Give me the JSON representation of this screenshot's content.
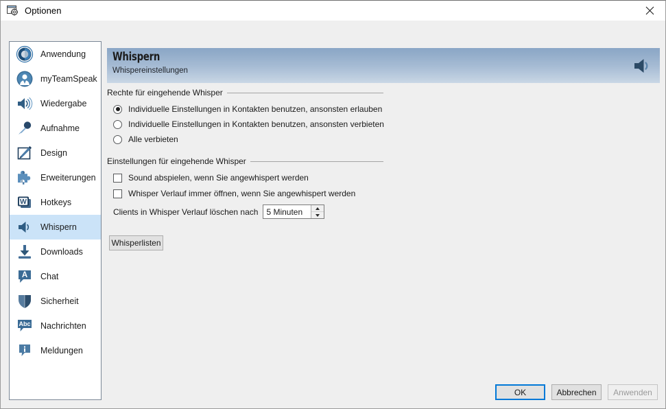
{
  "window": {
    "title": "Optionen",
    "icon": "options-window-icon",
    "close_label": "×"
  },
  "sidebar": {
    "items": [
      {
        "label": "Anwendung",
        "icon": "application-icon",
        "selected": false
      },
      {
        "label": "myTeamSpeak",
        "icon": "user-account-icon",
        "selected": false
      },
      {
        "label": "Wiedergabe",
        "icon": "playback-icon",
        "selected": false
      },
      {
        "label": "Aufnahme",
        "icon": "microphone-icon",
        "selected": false
      },
      {
        "label": "Design",
        "icon": "design-pencil-icon",
        "selected": false
      },
      {
        "label": "Erweiterungen",
        "icon": "puzzle-icon",
        "selected": false
      },
      {
        "label": "Hotkeys",
        "icon": "hotkeys-key-icon",
        "selected": false
      },
      {
        "label": "Whispern",
        "icon": "whisper-icon",
        "selected": true
      },
      {
        "label": "Downloads",
        "icon": "download-icon",
        "selected": false
      },
      {
        "label": "Chat",
        "icon": "chat-bubble-icon",
        "selected": false
      },
      {
        "label": "Sicherheit",
        "icon": "shield-icon",
        "selected": false
      },
      {
        "label": "Nachrichten",
        "icon": "abc-message-icon",
        "selected": false
      },
      {
        "label": "Meldungen",
        "icon": "info-icon",
        "selected": false
      }
    ]
  },
  "banner": {
    "title": "Whispern",
    "subtitle": "Whispereinstellungen",
    "icon": "speaker-icon"
  },
  "groups": {
    "rights": {
      "title": "Rechte für eingehende Whisper",
      "options": [
        {
          "label": "Individuelle Einstellungen in Kontakten benutzen, ansonsten erlauben",
          "checked": true
        },
        {
          "label": "Individuelle Einstellungen in Kontakten benutzen, ansonsten verbieten",
          "checked": false
        },
        {
          "label": "Alle verbieten",
          "checked": false
        }
      ]
    },
    "settings": {
      "title": "Einstellungen für eingehende Whisper",
      "checkboxes": [
        {
          "label": "Sound abspielen, wenn Sie angewhispert werden",
          "checked": false
        },
        {
          "label": "Whisper Verlauf immer öffnen, wenn Sie angewhispert werden",
          "checked": false
        }
      ],
      "spinner": {
        "label": "Clients in Whisper Verlauf löschen nach",
        "value": "5 Minuten"
      }
    }
  },
  "buttons": {
    "whisperlists": "Whisperlisten",
    "ok": "OK",
    "cancel": "Abbrechen",
    "apply": "Anwenden"
  },
  "colors": {
    "accent": "#0078d7",
    "selection": "#cbe3f8",
    "banner_top": "#8aa6c6",
    "banner_bottom": "#cbd8e6",
    "background": "#efefef"
  }
}
